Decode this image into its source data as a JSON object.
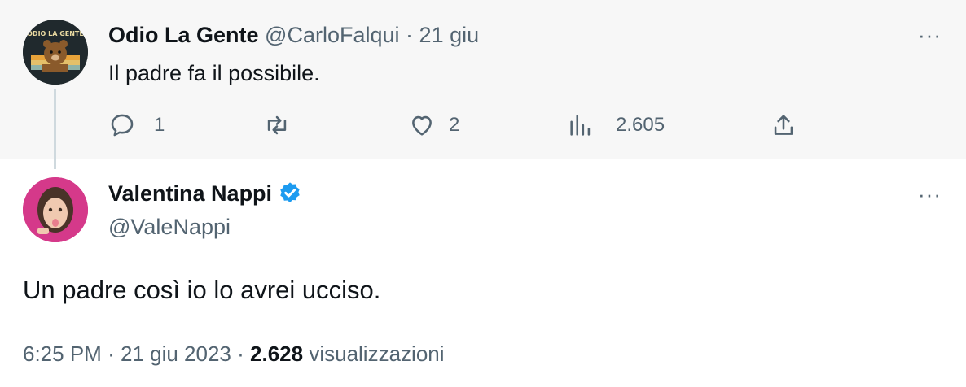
{
  "reply": {
    "display_name": "Odio La Gente",
    "handle": "@CarloFalqui",
    "separator": "·",
    "date": "21 giu",
    "text": "Il padre fa il possibile.",
    "avatar_text": "ODIO LA GENTE",
    "more": "···",
    "actions": {
      "replies": "1",
      "retweets": "",
      "likes": "2",
      "views": "2.605"
    }
  },
  "tweet": {
    "display_name": "Valentina Nappi",
    "verified": true,
    "handle": "@ValeNappi",
    "more": "···",
    "text": "Un padre così io lo avrei ucciso.",
    "time": "6:25 PM",
    "sep1": "·",
    "date": "21 giu 2023",
    "sep2": "·",
    "views_count": "2.628",
    "views_label": "visualizzazioni"
  },
  "colors": {
    "verified": "#1d9bf0",
    "muted": "#536471",
    "reply_bg": "#f7f7f7"
  }
}
